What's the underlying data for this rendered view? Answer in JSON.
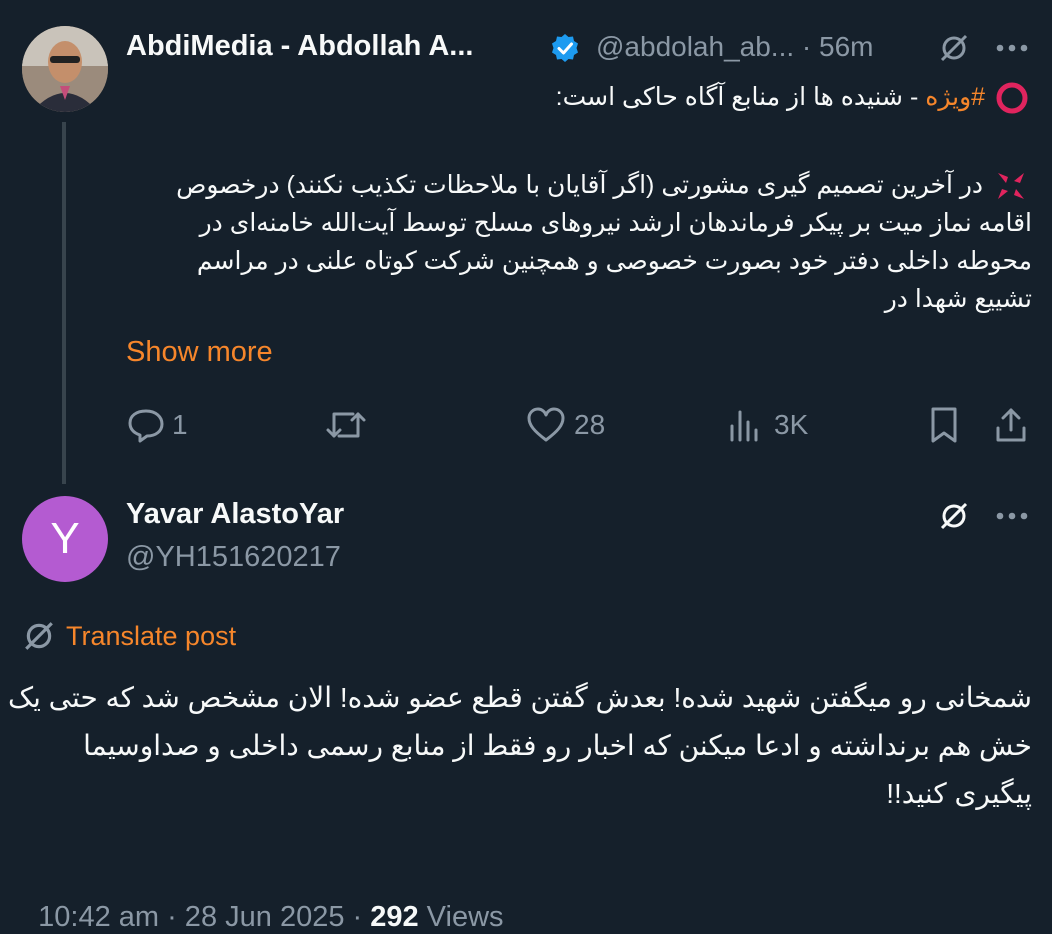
{
  "post1": {
    "author_name": "AbdiMedia - Abdollah A...",
    "handle": "@abdolah_ab...",
    "separator": "·",
    "time": "56m",
    "hashtag": "#ویژه",
    "headline_rest": " - شنیده ها از منابع آگاه حاکی است:",
    "body_lines": [
      "در آخرین تصمیم گیری مشورتی (اگر آقایان با ملاحظات تکذیب نکنند) درخصوص",
      "اقامه نماز میت بر پیکر فرماندهان ارشد نیروهای مسلح توسط آیت‌الله خامنه‌ای در",
      "محوطه داخلی دفتر خود بصورت خصوصی و همچنین شرکت کوتاه علنی در مراسم",
      "تشییع شهدا در"
    ],
    "show_more": "Show more",
    "stats": {
      "replies": "1",
      "likes": "28",
      "views": "3K"
    }
  },
  "post2": {
    "author_name": "Yavar AlastoYar",
    "handle": "@YH151620217",
    "avatar_letter": "Y",
    "translate_label": "Translate post",
    "text_lines": [
      "شمخانی رو میگفتن شهید شده! بعدش گفتن قطع عضو شده! الان مشخص شد که حتی یک",
      "خش هم برنداشته و ادعا میکنن که اخبار رو فقط از منابع رسمی داخلی و صداوسیما",
      "پیگیری کنید!!"
    ],
    "timestamp": "10:42 am · 28 Jun 2025 · ",
    "views_count": "292",
    "views_label": " Views"
  },
  "colors": {
    "background": "#15202b",
    "text": "#f7f9f9",
    "muted": "#8b98a5",
    "accent": "#f6862b",
    "verified": "#1d9bf0",
    "avatar_y": "#b45bd1"
  },
  "icons": [
    "verified-badge-icon",
    "grok-icon",
    "more-icon",
    "red-circle-emoji",
    "anger-emoji",
    "reply-icon",
    "repost-icon",
    "like-icon",
    "views-icon",
    "bookmark-icon",
    "share-icon",
    "translate-icon"
  ]
}
